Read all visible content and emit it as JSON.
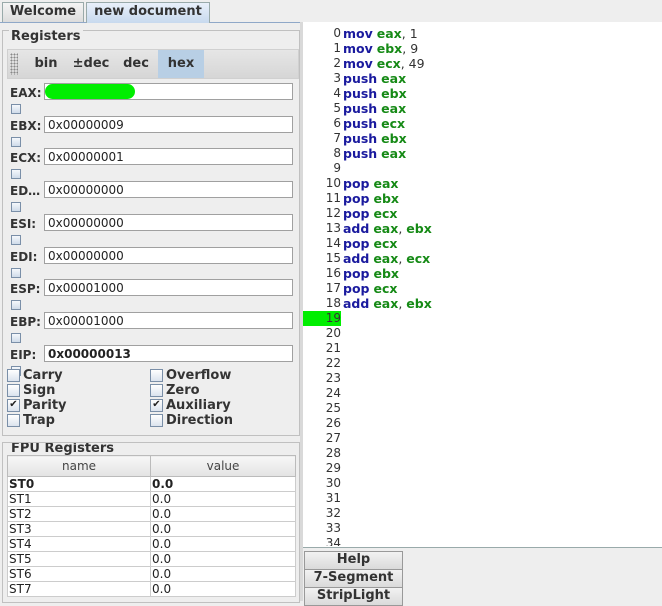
{
  "tabs": [
    {
      "label": "Welcome",
      "active": false
    },
    {
      "label": "new document",
      "active": true
    }
  ],
  "registers_panel": {
    "title": "Registers",
    "bases": [
      "bin",
      "±dec",
      "dec",
      "hex"
    ],
    "selected_base": "hex",
    "registers": [
      {
        "name": "EAX:",
        "value": ""
      },
      {
        "name": "EBX:",
        "value": "0x00000009"
      },
      {
        "name": "ECX:",
        "value": "0x00000001"
      },
      {
        "name": "ED…",
        "value": "0x00000000"
      },
      {
        "name": "ESI:",
        "value": "0x00000000"
      },
      {
        "name": "EDI:",
        "value": "0x00000000"
      },
      {
        "name": "ESP:",
        "value": "0x00001000"
      },
      {
        "name": "EBP:",
        "value": "0x00001000"
      },
      {
        "name": "EIP:",
        "value": "0x00000013"
      }
    ],
    "eax_highlight_color": "#00ee00",
    "flags": [
      {
        "label": "Carry",
        "checked": false
      },
      {
        "label": "Overflow",
        "checked": false
      },
      {
        "label": "Sign",
        "checked": false
      },
      {
        "label": "Zero",
        "checked": false
      },
      {
        "label": "Parity",
        "checked": true
      },
      {
        "label": "Auxiliary",
        "checked": true
      },
      {
        "label": "Trap",
        "checked": false
      },
      {
        "label": "Direction",
        "checked": false
      }
    ]
  },
  "fpu_panel": {
    "title": "FPU Registers",
    "columns": [
      "name",
      "value"
    ],
    "rows": [
      {
        "name": "ST0",
        "value": "0.0"
      },
      {
        "name": "ST1",
        "value": "0.0"
      },
      {
        "name": "ST2",
        "value": "0.0"
      },
      {
        "name": "ST3",
        "value": "0.0"
      },
      {
        "name": "ST4",
        "value": "0.0"
      },
      {
        "name": "ST5",
        "value": "0.0"
      },
      {
        "name": "ST6",
        "value": "0.0"
      },
      {
        "name": "ST7",
        "value": "0.0"
      }
    ]
  },
  "editor": {
    "current_line": 19,
    "current_line_color": "#00ee00",
    "lines": [
      {
        "n": "0",
        "op": "mov",
        "args": [
          [
            "eax",
            "r"
          ],
          [
            ", ",
            "p"
          ],
          [
            "1",
            "n"
          ]
        ]
      },
      {
        "n": "1",
        "op": "mov",
        "args": [
          [
            "ebx",
            "r"
          ],
          [
            ", ",
            "p"
          ],
          [
            "9",
            "n"
          ]
        ]
      },
      {
        "n": "2",
        "op": "mov",
        "args": [
          [
            "ecx",
            "r"
          ],
          [
            ", ",
            "p"
          ],
          [
            "49",
            "n"
          ]
        ]
      },
      {
        "n": "3",
        "op": "push",
        "args": [
          [
            "eax",
            "r"
          ]
        ]
      },
      {
        "n": "4",
        "op": "push",
        "args": [
          [
            "ebx",
            "r"
          ]
        ]
      },
      {
        "n": "5",
        "op": "push",
        "args": [
          [
            "eax",
            "r"
          ]
        ]
      },
      {
        "n": "6",
        "op": "push",
        "args": [
          [
            "ecx",
            "r"
          ]
        ]
      },
      {
        "n": "7",
        "op": "push",
        "args": [
          [
            "ebx",
            "r"
          ]
        ]
      },
      {
        "n": "8",
        "op": "push",
        "args": [
          [
            "eax",
            "r"
          ]
        ]
      },
      {
        "n": "9",
        "op": "",
        "args": []
      },
      {
        "n": "10",
        "op": "pop",
        "args": [
          [
            "eax",
            "r"
          ]
        ]
      },
      {
        "n": "11",
        "op": "pop",
        "args": [
          [
            "ebx",
            "r"
          ]
        ]
      },
      {
        "n": "12",
        "op": "pop",
        "args": [
          [
            "ecx",
            "r"
          ]
        ]
      },
      {
        "n": "13",
        "op": "add",
        "args": [
          [
            "eax",
            "r"
          ],
          [
            ", ",
            "p"
          ],
          [
            "ebx",
            "r"
          ]
        ]
      },
      {
        "n": "14",
        "op": "pop",
        "args": [
          [
            "ecx",
            "r"
          ]
        ]
      },
      {
        "n": "15",
        "op": "add",
        "args": [
          [
            "eax",
            "r"
          ],
          [
            ", ",
            "p"
          ],
          [
            "ecx",
            "r"
          ]
        ]
      },
      {
        "n": "16",
        "op": "pop",
        "args": [
          [
            "ebx",
            "r"
          ]
        ]
      },
      {
        "n": "17",
        "op": "pop",
        "args": [
          [
            "ecx",
            "r"
          ]
        ]
      },
      {
        "n": "18",
        "op": "add",
        "args": [
          [
            "eax",
            "r"
          ],
          [
            ", ",
            "p"
          ],
          [
            "ebx",
            "r"
          ]
        ]
      },
      {
        "n": "19",
        "op": "",
        "args": []
      },
      {
        "n": "20",
        "op": "",
        "args": []
      },
      {
        "n": "21",
        "op": "",
        "args": []
      },
      {
        "n": "22",
        "op": "",
        "args": []
      },
      {
        "n": "23",
        "op": "",
        "args": []
      },
      {
        "n": "24",
        "op": "",
        "args": []
      },
      {
        "n": "25",
        "op": "",
        "args": []
      },
      {
        "n": "26",
        "op": "",
        "args": []
      },
      {
        "n": "27",
        "op": "",
        "args": []
      },
      {
        "n": "28",
        "op": "",
        "args": []
      },
      {
        "n": "29",
        "op": "",
        "args": []
      },
      {
        "n": "30",
        "op": "",
        "args": []
      },
      {
        "n": "31",
        "op": "",
        "args": []
      },
      {
        "n": "32",
        "op": "",
        "args": []
      },
      {
        "n": "33",
        "op": "",
        "args": []
      },
      {
        "n": "34",
        "op": "",
        "args": []
      }
    ]
  },
  "bottom_tabs": [
    "Help",
    "7-Segment",
    "StripLight"
  ]
}
